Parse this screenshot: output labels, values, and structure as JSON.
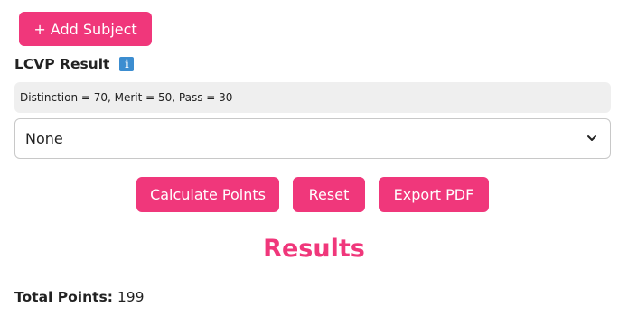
{
  "add_subject": {
    "label": "+ Add Subject"
  },
  "lcvp": {
    "label": "LCVP Result",
    "info_icon_glyph": "i",
    "hint": "Distinction = 70, Merit = 50, Pass = 30",
    "select_value": "None"
  },
  "actions": {
    "calculate": "Calculate Points",
    "reset": "Reset",
    "export": "Export PDF"
  },
  "results": {
    "heading": "Results",
    "total_label": "Total Points:",
    "total_value": "199"
  },
  "colors": {
    "accent": "#f0377b",
    "info": "#3c8dd0",
    "hint_bg": "#efefef"
  }
}
